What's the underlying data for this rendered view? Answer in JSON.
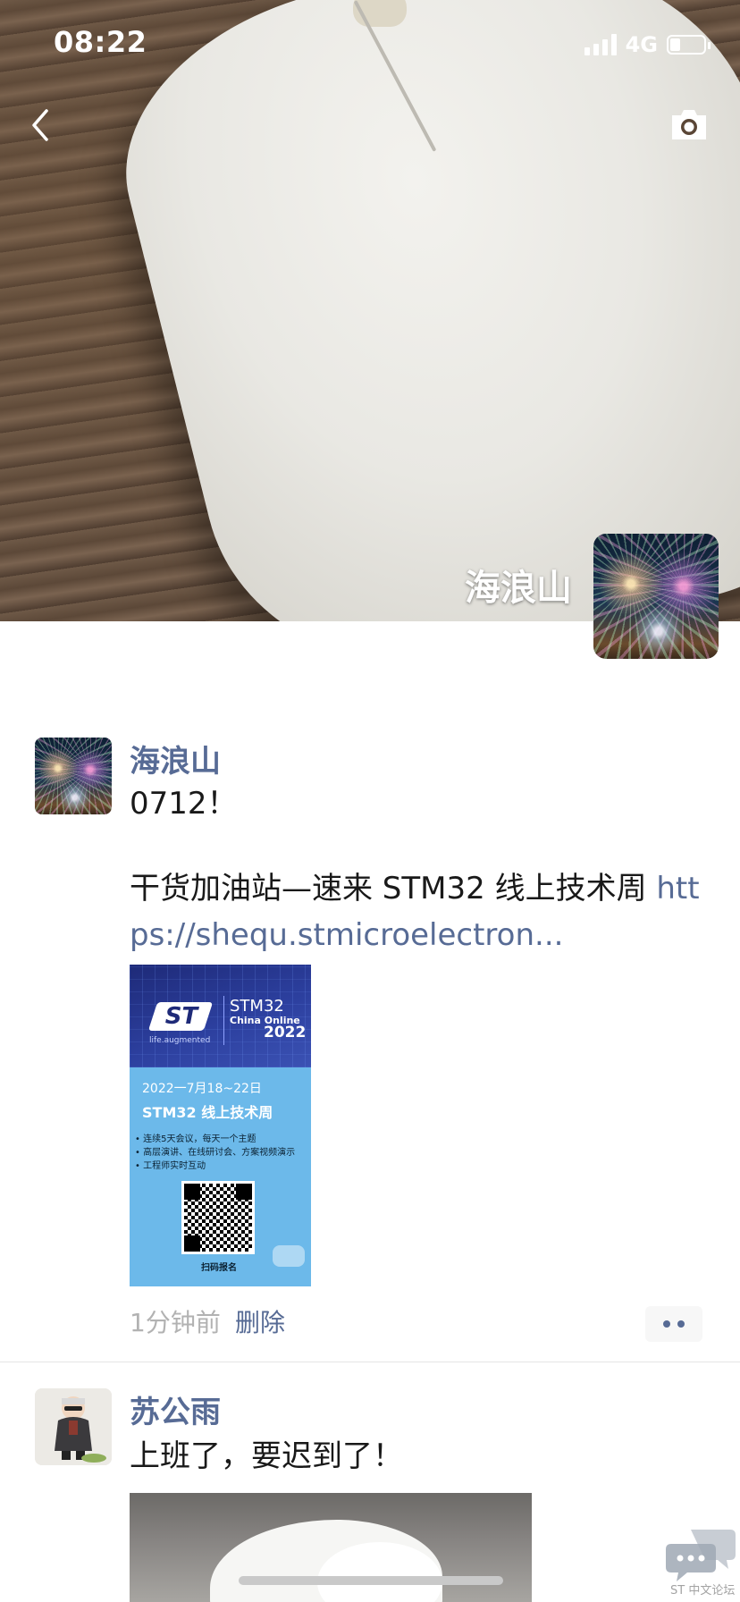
{
  "status_bar": {
    "time": "08:22",
    "network": "4G",
    "battery_fraction": 0.3
  },
  "cover": {
    "name": "海浪山"
  },
  "post1": {
    "author": "海浪山",
    "line1": "0712！",
    "line2_text": "干货加油站—速来 STM32 线上技术周 ",
    "line2_link": "https://shequ.stmicroelectron...",
    "poster": {
      "logo": "ST",
      "tagline": "life.augmented",
      "brand": "STM32",
      "event": "China Online",
      "year": "2022",
      "date": "2022一7月18~22日",
      "title": "STM32 线上技术周",
      "bullets": [
        "• 连续5天会议，每天一个主题",
        "• 高层演讲、在线研讨会、方案视频演示",
        "• 工程师实时互动"
      ],
      "scan": "扫码报名"
    },
    "time_ago": "1分钟前",
    "delete_label": "删除"
  },
  "post2": {
    "author": "苏公雨",
    "text": "上班了，要迟到了！"
  },
  "watermark": {
    "text": "ST 中文论坛"
  }
}
